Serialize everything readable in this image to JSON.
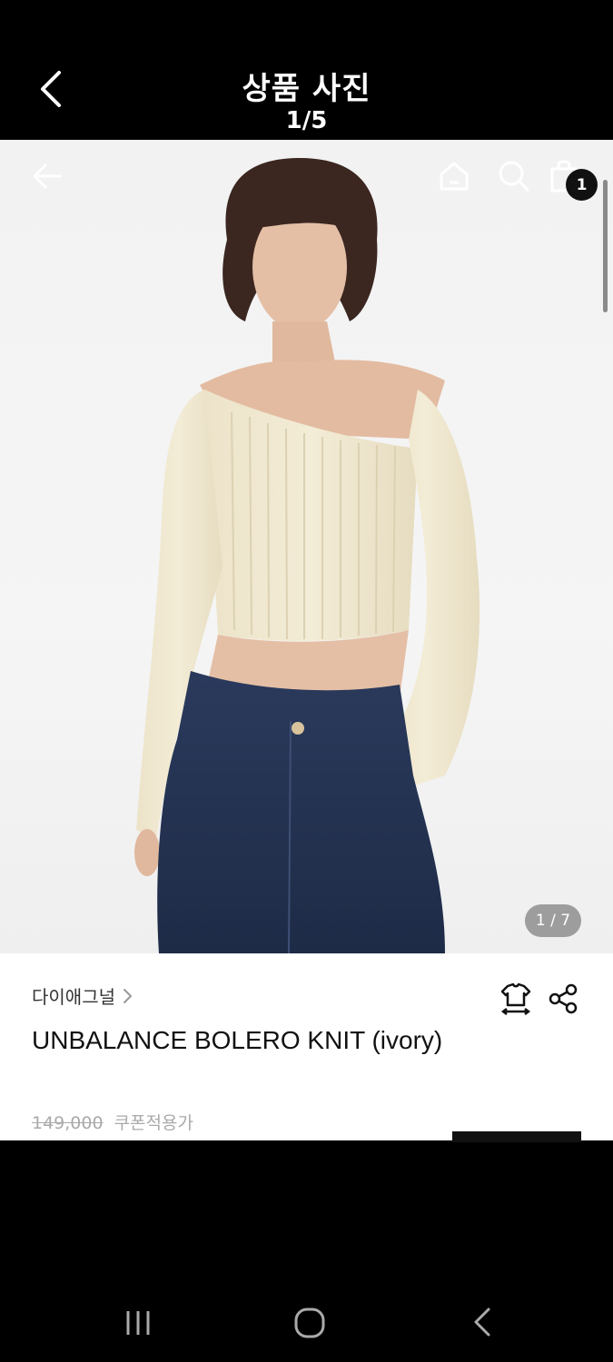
{
  "header": {
    "title": "상품 사진",
    "counter": "1/5"
  },
  "photo": {
    "image_counter": "1 / 7",
    "cart_count": "1"
  },
  "product": {
    "brand": "다이애그널",
    "name": "UNBALANCE BOLERO KNIT (ivory)",
    "original_price": "149,000",
    "coupon_label": "쿠폰적용가"
  },
  "icons": {
    "header_back": "chevron-left-icon",
    "photo_back": "arrow-left-icon",
    "home": "home-icon",
    "search": "search-icon",
    "bag": "shopping-bag-icon",
    "brand_chevron": "chevron-right-icon",
    "size_guide": "size-guide-shirt-icon",
    "share": "share-icon"
  },
  "colors": {
    "header_bg": "#000000",
    "badge_bg": "#111111",
    "counter_pill": "#828282"
  }
}
